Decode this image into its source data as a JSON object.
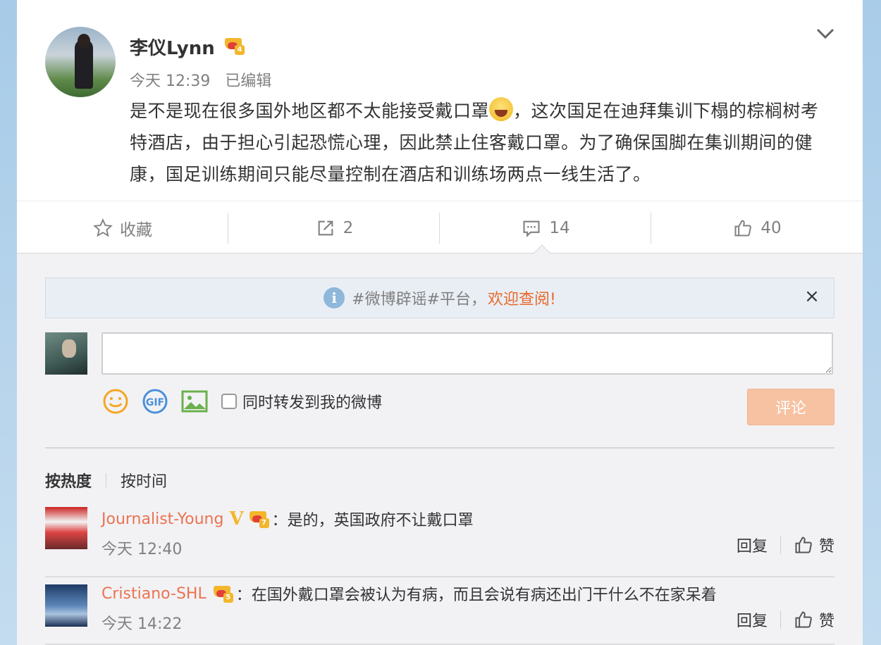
{
  "post": {
    "author": "李仪Lynn",
    "vip_level": "4",
    "time": "今天 12:39",
    "edited": "已编辑",
    "text_part1": "是不是现在很多国外地区都不太能接受戴口罩",
    "text_part2": "，这次国足在迪拜集训下榻的棕榈树考特酒店，由于担心引起恐慌心理，因此禁止住客戴口罩。为了确保国脚在集训期间的健康，国足训练期间只能尽量控制在酒店和训练场两点一线生活了。"
  },
  "actions": {
    "favorite": "收藏",
    "repost_count": "2",
    "comment_count": "14",
    "like_count": "40"
  },
  "notice": {
    "prefix": "#微博辟谣#平台，",
    "link": "欢迎查阅!",
    "close": "×"
  },
  "composer": {
    "input_value": "",
    "sync_label": "同时转发到我的微博",
    "submit_label": "评论"
  },
  "sort": {
    "hot": "按热度",
    "time": "按时间"
  },
  "comments": [
    {
      "user": "Journalist-Young",
      "vip_level": "7",
      "verified": "V",
      "text": "：是的，英国政府不让戴口罩",
      "time": "今天 12:40",
      "reply": "回复",
      "like": "赞"
    },
    {
      "user": "Cristiano-SHL",
      "vip_level": "5",
      "text": "：在国外戴口罩会被认为有病，而且会说有病还出门干什么不在家呆着",
      "time": "今天 14:22",
      "reply": "回复",
      "like": "赞"
    }
  ],
  "colors": {
    "accent": "#eb7350",
    "link": "#e8692b",
    "submit_disabled": "#f7c2a2",
    "crown": "#f3b62c"
  }
}
